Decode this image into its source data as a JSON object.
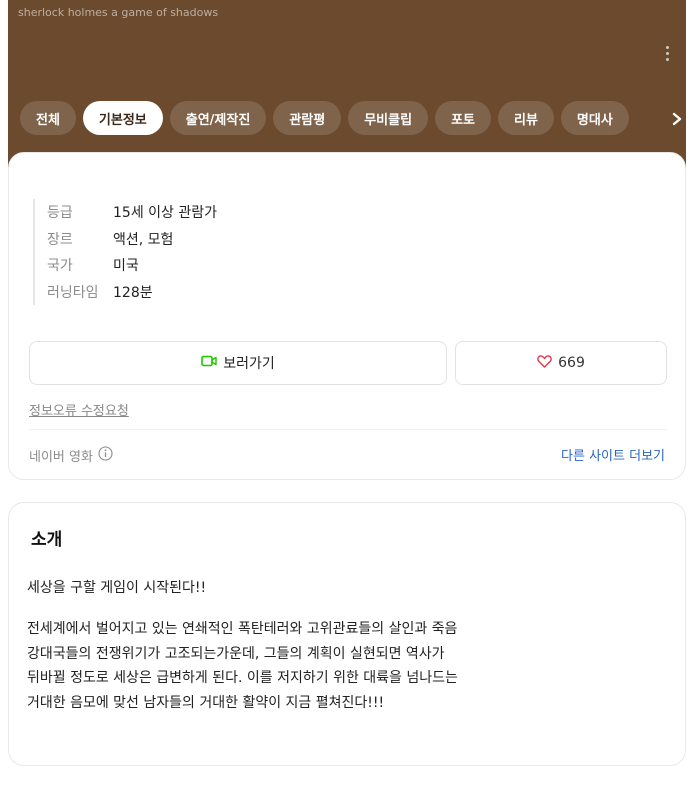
{
  "header": {
    "subtitle": "sherlock holmes a game of shadows"
  },
  "tabs": [
    {
      "label": "전체"
    },
    {
      "label": "기본정보",
      "active": true
    },
    {
      "label": "출연/제작진"
    },
    {
      "label": "관람평"
    },
    {
      "label": "무비클립"
    },
    {
      "label": "포토"
    },
    {
      "label": "리뷰"
    },
    {
      "label": "명대사"
    }
  ],
  "info": [
    {
      "key": "등급",
      "value": "15세 이상 관람가"
    },
    {
      "key": "장르",
      "value": "액션, 모험"
    },
    {
      "key": "국가",
      "value": "미국"
    },
    {
      "key": "러닝타임",
      "value": "128분"
    }
  ],
  "actions": {
    "watch_label": "보러가기",
    "like_count": "669"
  },
  "report_label": "정보오류 수정요청",
  "source": {
    "label": "네이버 영화",
    "more_label": "다른 사이트 더보기"
  },
  "intro": {
    "title": "소개",
    "tagline": "세상을 구할 게임이 시작된다!!",
    "body_lines": [
      "전세계에서 벌어지고 있는 연쇄적인 폭탄테러와 고위관료들의 살인과 죽음",
      "강대국들의 전쟁위기가 고조되는가운데, 그들의 계획이 실현되면 역사가",
      "뒤바뀔 정도로 세상은 급변하게 된다. 이를 저지하기 위한 대륙을 넘나드는",
      "거대한 음모에 맞선 남자들의 거대한 활약이 지금 펼쳐진다!!!"
    ]
  },
  "colors": {
    "header_bg": "#6b4a2e",
    "watch_icon": "#1ec800",
    "heart_icon": "#e8334a",
    "link": "#2a64c9"
  },
  "icons": {
    "kebab": "more-vertical-icon",
    "next": "chevron-right-icon",
    "watch": "video-camera-icon",
    "heart": "heart-outline-icon",
    "info": "info-circle-icon"
  }
}
